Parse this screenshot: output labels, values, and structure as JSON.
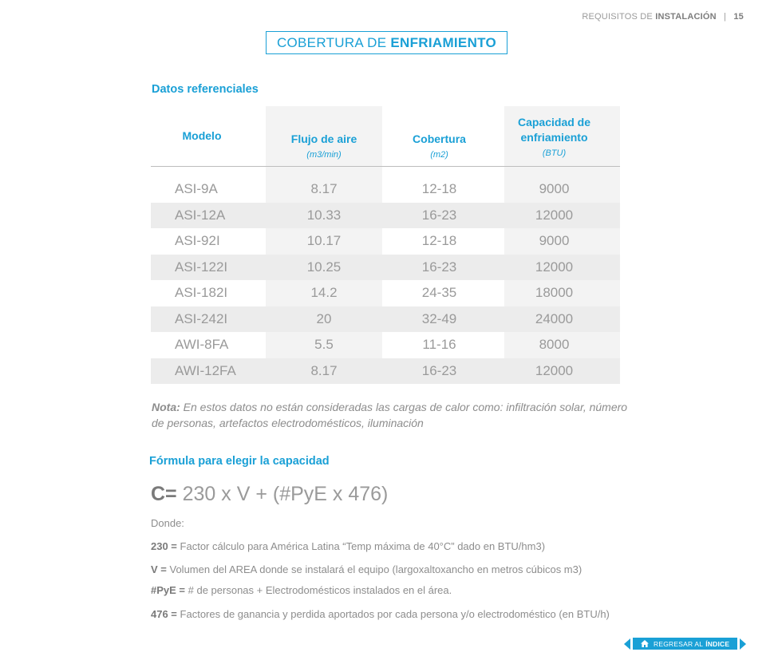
{
  "header": {
    "section_prefix": "REQUISITOS DE",
    "section_bold": "INSTALACIÓN",
    "separator": "|",
    "page_number": "15"
  },
  "title": {
    "prefix": "COBERTURA DE",
    "bold": "ENFRIAMIENTO"
  },
  "reference": {
    "heading": "Datos referenciales",
    "columns": [
      {
        "label": "Modelo",
        "unit": ""
      },
      {
        "label": "Flujo de aire",
        "unit": "(m3/min)"
      },
      {
        "label": "Cobertura",
        "unit": "(m2)"
      },
      {
        "label": "Capacidad de enfriamiento",
        "unit": "(BTU)"
      }
    ],
    "rows": [
      [
        "ASI-9A",
        "8.17",
        "12-18",
        "9000"
      ],
      [
        "ASI-12A",
        "10.33",
        "16-23",
        "12000"
      ],
      [
        "ASI-92I",
        "10.17",
        "12-18",
        "9000"
      ],
      [
        "ASI-122I",
        "10.25",
        "16-23",
        "12000"
      ],
      [
        "ASI-182I",
        "14.2",
        "24-35",
        "18000"
      ],
      [
        "ASI-242I",
        "20",
        "32-49",
        "24000"
      ],
      [
        "AWI-8FA",
        "5.5",
        "11-16",
        "8000"
      ],
      [
        "AWI-12FA",
        "8.17",
        "16-23",
        "12000"
      ]
    ]
  },
  "note": {
    "label": "Nota:",
    "text": "En estos datos no están consideradas las cargas de calor como: infiltración solar, número de personas, artefactos electrodomésticos, iluminación"
  },
  "formula_section": {
    "heading": "Fórmula para elegir la capacidad",
    "formula_lhs": "C=",
    "formula_rhs": "230 x V + (#PyE x 476)",
    "where": "Donde:",
    "definitions": [
      {
        "term": "230 =",
        "text": "Factor cálculo para América Latina “Temp máxima de 40°C” dado en BTU/hm3)"
      },
      {
        "term": "V =",
        "text": "Volumen del AREA donde se instalará el equipo (largoxaltoxancho en metros cúbicos m3)"
      },
      {
        "term": "#PyE =",
        "text": "# de personas + Electrodomésticos instalados en el área."
      },
      {
        "term": "476 =",
        "text": "Factores de ganancia y perdida aportados por cada persona y/o electrodoméstico (en BTU/h)"
      }
    ]
  },
  "footer": {
    "back_prefix": "REGRESAR AL",
    "back_bold": "ÍNDICE",
    "icon": "home-icon"
  },
  "colors": {
    "accent": "#1aa0d6",
    "text": "#8a8a8a",
    "row_alt": "#ececec",
    "col_shade": "#f3f3f3"
  }
}
